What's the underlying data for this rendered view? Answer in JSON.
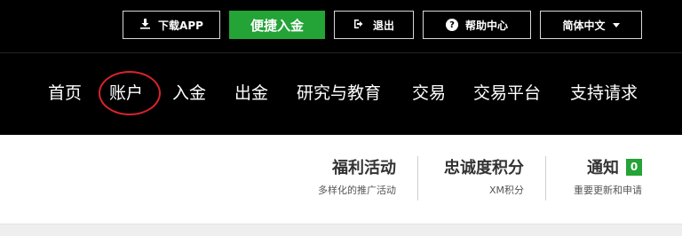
{
  "topbar": {
    "download_label": "下载APP",
    "deposit_label": "便捷入金",
    "logout_label": "退出",
    "help_label": "帮助中心",
    "language_label": "简体中文"
  },
  "nav": {
    "items": [
      "首页",
      "账户",
      "入金",
      "出金",
      "研究与教育",
      "交易",
      "交易平台",
      "支持请求"
    ]
  },
  "cards": [
    {
      "title": "福利活动",
      "subtitle": "多样化的推广活动"
    },
    {
      "title": "忠诚度积分",
      "subtitle": "XM积分"
    },
    {
      "title": "通知",
      "subtitle": "重要更新和申请",
      "badge": "0"
    }
  ],
  "colors": {
    "accent_green": "#24a337",
    "highlight_ring": "#d8232a",
    "header_bg": "#000000"
  }
}
